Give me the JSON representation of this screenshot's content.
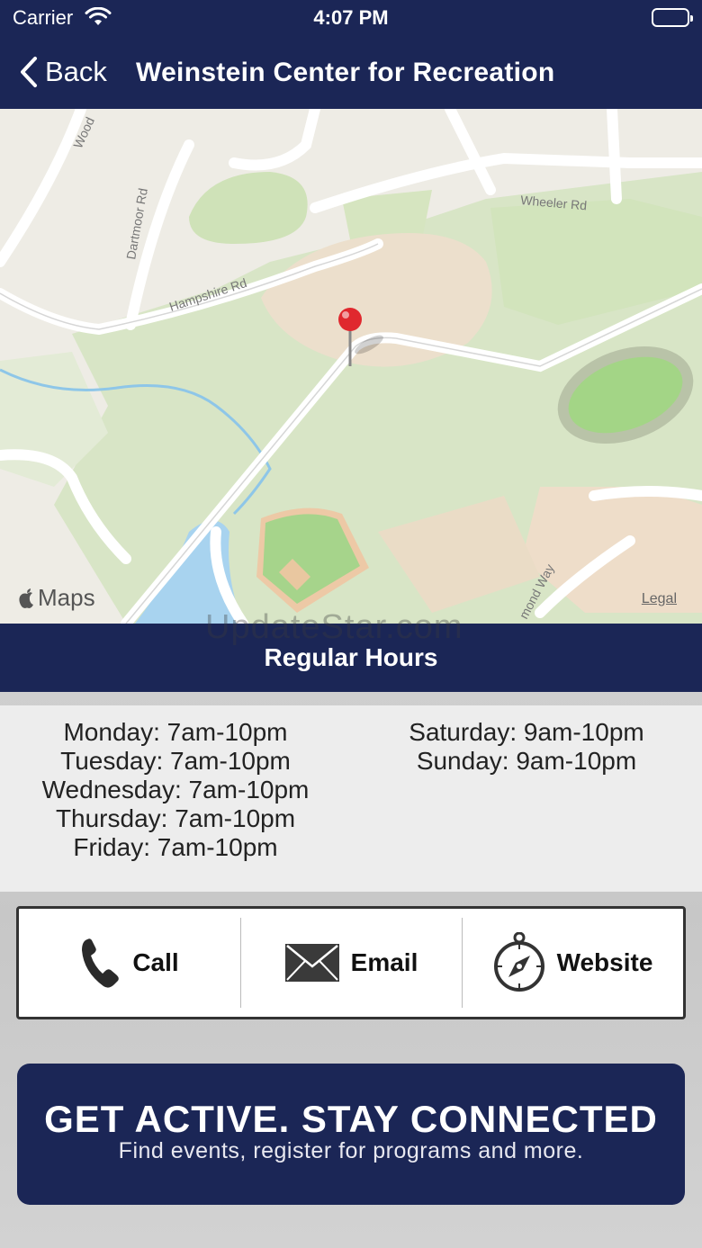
{
  "status_bar": {
    "carrier": "Carrier",
    "time": "4:07 PM"
  },
  "nav": {
    "back_label": "Back",
    "title": "Weinstein Center for Recreation"
  },
  "map": {
    "streets": [
      "Wood",
      "Dartmoor Rd",
      "Hampshire Rd",
      "Wheeler Rd",
      "mond Way"
    ],
    "attribution": "Maps",
    "legal": "Legal"
  },
  "watermark": "UpdateStar.com",
  "hours": {
    "title": "Regular Hours",
    "left": [
      "Monday: 7am-10pm",
      "Tuesday: 7am-10pm",
      "Wednesday: 7am-10pm",
      "Thursday: 7am-10pm",
      "Friday: 7am-10pm"
    ],
    "right": [
      "Saturday: 9am-10pm",
      "Sunday: 9am-10pm"
    ]
  },
  "contact": {
    "call": {
      "label": "Call",
      "icon": "phone-icon"
    },
    "email": {
      "label": "Email",
      "icon": "envelope-icon"
    },
    "website": {
      "label": "Website",
      "icon": "compass-icon"
    }
  },
  "banner": {
    "headline": "GET ACTIVE.  STAY CONNECTED",
    "subline": "Find events, register for programs and more."
  },
  "colors": {
    "navy": "#1b2656",
    "pin": "#e0282e"
  }
}
